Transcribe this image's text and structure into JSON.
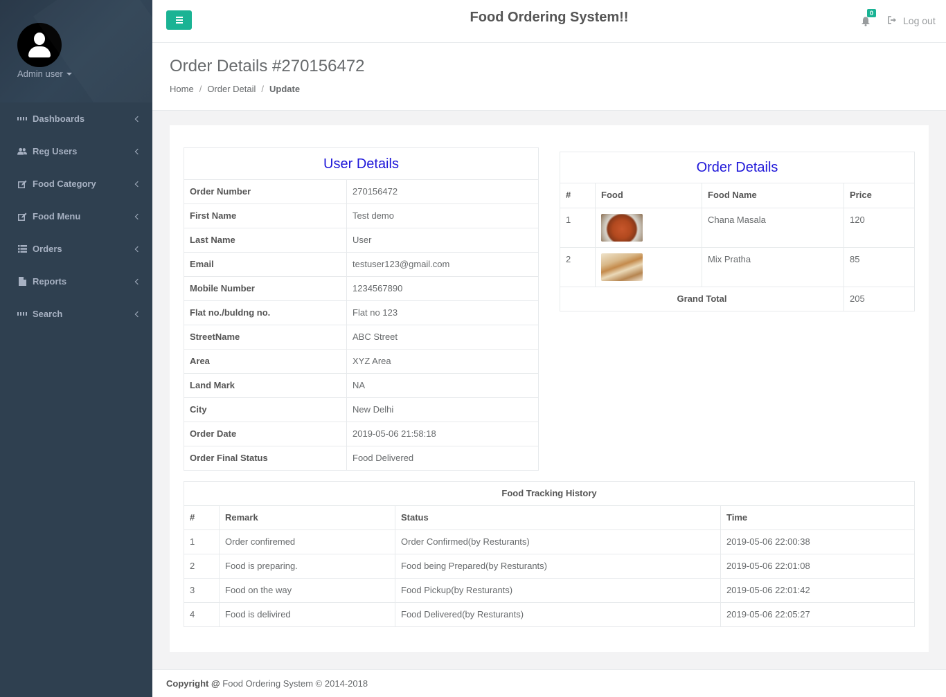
{
  "sidebar": {
    "user_name": "Admin user",
    "items": [
      {
        "label": "Dashboards",
        "icon": "th-large-icon"
      },
      {
        "label": "Reg Users",
        "icon": "users-icon"
      },
      {
        "label": "Food Category",
        "icon": "edit-icon"
      },
      {
        "label": "Food Menu",
        "icon": "edit-icon"
      },
      {
        "label": "Orders",
        "icon": "list-icon"
      },
      {
        "label": "Reports",
        "icon": "file-icon"
      },
      {
        "label": "Search",
        "icon": "th-large-icon"
      }
    ]
  },
  "topbar": {
    "title": "Food Ordering System!!",
    "notification_count": "0",
    "logout_label": "Log out"
  },
  "heading": {
    "title": "Order Details #270156472",
    "breadcrumb": [
      "Home",
      "Order Detail",
      "Update"
    ]
  },
  "user_details": {
    "title": "User Details",
    "rows": [
      {
        "label": "Order Number",
        "value": "270156472"
      },
      {
        "label": "First Name",
        "value": "Test demo"
      },
      {
        "label": "Last Name",
        "value": "User"
      },
      {
        "label": "Email",
        "value": "testuser123@gmail.com"
      },
      {
        "label": "Mobile Number",
        "value": "1234567890"
      },
      {
        "label": "Flat no./buldng no.",
        "value": "Flat no 123"
      },
      {
        "label": "StreetName",
        "value": "ABC Street"
      },
      {
        "label": "Area",
        "value": "XYZ Area"
      },
      {
        "label": "Land Mark",
        "value": "NA"
      },
      {
        "label": "City",
        "value": "New Delhi"
      },
      {
        "label": "Order Date",
        "value": "2019-05-06 21:58:18"
      },
      {
        "label": "Order Final Status",
        "value": "Food Delivered"
      }
    ]
  },
  "order_details": {
    "title": "Order Details",
    "headers": [
      "#",
      "Food",
      "Food Name",
      "Price"
    ],
    "items": [
      {
        "num": "1",
        "image": "chana-masala-photo",
        "name": "Chana Masala",
        "price": "120"
      },
      {
        "num": "2",
        "image": "mix-pratha-photo",
        "name": "Mix Pratha",
        "price": "85"
      }
    ],
    "grand_total_label": "Grand Total",
    "grand_total": "205"
  },
  "tracking": {
    "title": "Food Tracking History",
    "headers": [
      "#",
      "Remark",
      "Status",
      "Time"
    ],
    "rows": [
      {
        "num": "1",
        "remark": "Order confiremed",
        "status": "Order Confirmed(by Resturants)",
        "time": "2019-05-06 22:00:38"
      },
      {
        "num": "2",
        "remark": "Food is preparing.",
        "status": "Food being Prepared(by Resturants)",
        "time": "2019-05-06 22:01:08"
      },
      {
        "num": "3",
        "remark": "Food on the way",
        "status": "Food Pickup(by Resturants)",
        "time": "2019-05-06 22:01:42"
      },
      {
        "num": "4",
        "remark": "Food is delivired",
        "status": "Food Delivered(by Resturants)",
        "time": "2019-05-06 22:05:27"
      }
    ]
  },
  "footer": {
    "copyright_label": "Copyright @",
    "copyright_text": "Food Ordering System © 2014-2018"
  },
  "colors": {
    "sidebar_bg": "#2f4050",
    "accent": "#1ab394",
    "section_title": "#1e16d9"
  }
}
